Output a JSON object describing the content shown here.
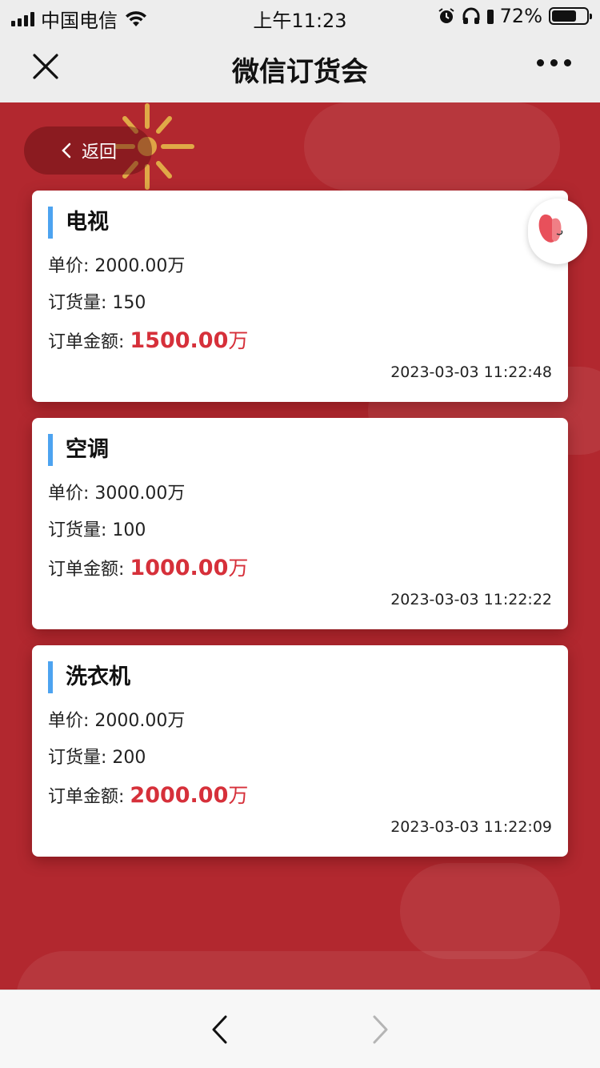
{
  "status_bar": {
    "carrier": "中国电信",
    "time": "上午11:23",
    "battery_percent": "72%",
    "battery_level": 0.72
  },
  "nav": {
    "title": "微信订货会"
  },
  "back_button": {
    "label": "返回"
  },
  "labels": {
    "price": "单价: ",
    "quantity": "订货量: ",
    "amount": "订单金额: "
  },
  "orders": [
    {
      "name": "电视",
      "price": "2000.00万",
      "quantity": "150",
      "amount": "1500.00",
      "amount_unit": "万",
      "time": "2023-03-03 11:22:48"
    },
    {
      "name": "空调",
      "price": "3000.00万",
      "quantity": "100",
      "amount": "1000.00",
      "amount_unit": "万",
      "time": "2023-03-03 11:22:22"
    },
    {
      "name": "洗衣机",
      "price": "2000.00万",
      "quantity": "200",
      "amount": "2000.00",
      "amount_unit": "万",
      "time": "2023-03-03 11:22:09"
    }
  ],
  "colors": {
    "background": "#b2282f",
    "accent_bar": "#4da3f0",
    "amount": "#d6303a"
  }
}
